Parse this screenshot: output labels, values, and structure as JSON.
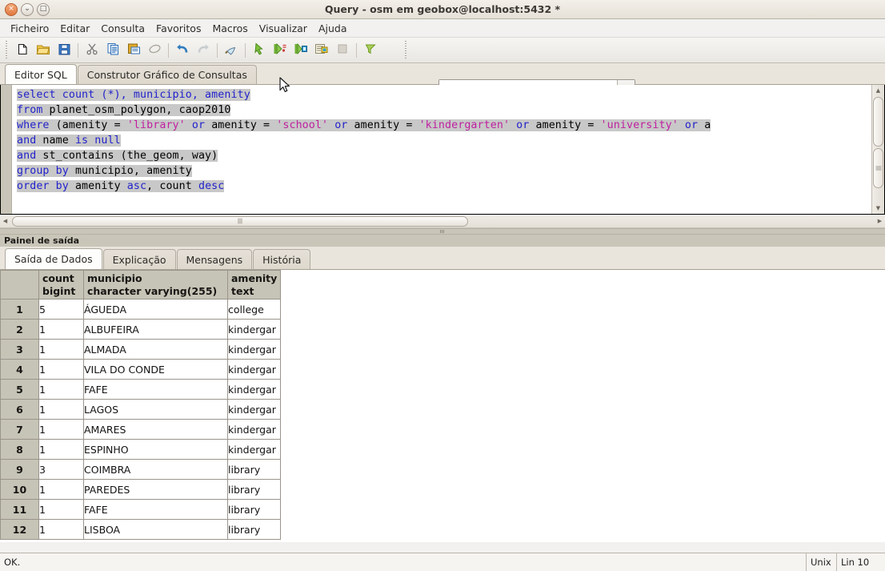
{
  "window": {
    "title": "Query - osm em geobox@localhost:5432 *",
    "buttons": {
      "close": "×",
      "minimize": "⌄",
      "maximize": "□"
    }
  },
  "menu": {
    "items": [
      {
        "label": "Ficheiro"
      },
      {
        "label": "Editar"
      },
      {
        "label": "Consulta"
      },
      {
        "label": "Favoritos"
      },
      {
        "label": "Macros"
      },
      {
        "label": "Visualizar"
      },
      {
        "label": "Ajuda"
      }
    ]
  },
  "toolbar": {
    "buttons": [
      {
        "name": "new-query-icon",
        "title": "Nova janela de consulta"
      },
      {
        "name": "open-file-icon",
        "title": "Abrir ficheiro"
      },
      {
        "name": "save-file-icon",
        "title": "Guardar"
      },
      {
        "name": "cut-icon",
        "title": "Cortar"
      },
      {
        "name": "copy-icon",
        "title": "Copiar"
      },
      {
        "name": "paste-icon",
        "title": "Colar"
      },
      {
        "name": "clear-window-icon",
        "title": "Limpar janela"
      },
      {
        "name": "undo-icon",
        "title": "Desfazer"
      },
      {
        "name": "redo-icon",
        "title": "Refazer"
      },
      {
        "name": "find-replace-icon",
        "title": "Procurar e substituir"
      },
      {
        "name": "execute-query-icon",
        "title": "Executar consulta"
      },
      {
        "name": "execute-to-file-icon",
        "title": "Executar para ficheiro"
      },
      {
        "name": "explain-query-icon",
        "title": "Explicar consulta"
      },
      {
        "name": "explain-analyze-icon",
        "title": "Explicar analisar"
      },
      {
        "name": "stop-icon",
        "title": "Cancelar"
      },
      {
        "name": "macros-icon",
        "title": "Macros"
      }
    ],
    "connection": {
      "value": "osm em geobox@localhost:5432",
      "arrow": "▼"
    }
  },
  "editor_tabs": {
    "items": [
      {
        "label": "Editor SQL",
        "active": true
      },
      {
        "label": "Construtor Gráfico de Consultas",
        "active": false
      }
    ]
  },
  "sql": {
    "lines": [
      [
        {
          "t": "select count (*), municipio, amenity",
          "c": "kw"
        }
      ],
      [
        {
          "t": "from ",
          "c": "kw"
        },
        {
          "t": "planet_osm_polygon, caop2010",
          "c": "pl"
        }
      ],
      [
        {
          "t": "where ",
          "c": "kw"
        },
        {
          "t": "(amenity = ",
          "c": "pl"
        },
        {
          "t": "'library'",
          "c": "str"
        },
        {
          "t": " or ",
          "c": "kw"
        },
        {
          "t": "amenity = ",
          "c": "pl"
        },
        {
          "t": "'school'",
          "c": "str"
        },
        {
          "t": " or ",
          "c": "kw"
        },
        {
          "t": "amenity = ",
          "c": "pl"
        },
        {
          "t": "'kindergarten'",
          "c": "str"
        },
        {
          "t": " or ",
          "c": "kw"
        },
        {
          "t": "amenity = ",
          "c": "pl"
        },
        {
          "t": "'university'",
          "c": "str"
        },
        {
          "t": " or ",
          "c": "kw"
        },
        {
          "t": "a",
          "c": "pl"
        }
      ],
      [
        {
          "t": "and ",
          "c": "kw"
        },
        {
          "t": "name ",
          "c": "pl"
        },
        {
          "t": "is null",
          "c": "kw"
        }
      ],
      [
        {
          "t": "and ",
          "c": "kw"
        },
        {
          "t": "st_contains (the_geom, way)",
          "c": "pl"
        }
      ],
      [
        {
          "t": "group by ",
          "c": "kw"
        },
        {
          "t": " municipio, amenity",
          "c": "pl"
        }
      ],
      [
        {
          "t": "order by ",
          "c": "kw"
        },
        {
          "t": "amenity ",
          "c": "pl"
        },
        {
          "t": "asc",
          "c": "kw"
        },
        {
          "t": ", count ",
          "c": "pl"
        },
        {
          "t": "desc",
          "c": "kw"
        }
      ]
    ]
  },
  "output_panel": {
    "caption": "Painel de saída",
    "tabs": [
      {
        "label": "Saída de Dados",
        "active": true
      },
      {
        "label": "Explicação",
        "active": false
      },
      {
        "label": "Mensagens",
        "active": false
      },
      {
        "label": "História",
        "active": false
      }
    ]
  },
  "grid": {
    "columns": [
      {
        "name": "",
        "type": ""
      },
      {
        "name": "count",
        "type": "bigint"
      },
      {
        "name": "municipio",
        "type": "character varying(255)"
      },
      {
        "name": "amenity",
        "type": "text"
      }
    ],
    "rows": [
      {
        "n": "1",
        "count": "5",
        "municipio": "ÁGUEDA",
        "amenity": "college"
      },
      {
        "n": "2",
        "count": "1",
        "municipio": "ALBUFEIRA",
        "amenity": "kindergar"
      },
      {
        "n": "3",
        "count": "1",
        "municipio": "ALMADA",
        "amenity": "kindergar"
      },
      {
        "n": "4",
        "count": "1",
        "municipio": "VILA DO CONDE",
        "amenity": "kindergar"
      },
      {
        "n": "5",
        "count": "1",
        "municipio": "FAFE",
        "amenity": "kindergar"
      },
      {
        "n": "6",
        "count": "1",
        "municipio": "LAGOS",
        "amenity": "kindergar"
      },
      {
        "n": "7",
        "count": "1",
        "municipio": "AMARES",
        "amenity": "kindergar"
      },
      {
        "n": "8",
        "count": "1",
        "municipio": "ESPINHO",
        "amenity": "kindergar"
      },
      {
        "n": "9",
        "count": "3",
        "municipio": "COIMBRA",
        "amenity": "library"
      },
      {
        "n": "10",
        "count": "1",
        "municipio": "PAREDES",
        "amenity": "library"
      },
      {
        "n": "11",
        "count": "1",
        "municipio": "FAFE",
        "amenity": "library"
      },
      {
        "n": "12",
        "count": "1",
        "municipio": "LISBOA",
        "amenity": "library"
      }
    ]
  },
  "statusbar": {
    "message": "OK.",
    "line_ending": "Unix",
    "position": "Lin 10"
  },
  "colors": {
    "keyword": "#2222cc",
    "string": "#c020a0",
    "selection": "#c8c8c8",
    "header_bg": "#c6c4b6",
    "titlebar_close": "#e07a42"
  }
}
